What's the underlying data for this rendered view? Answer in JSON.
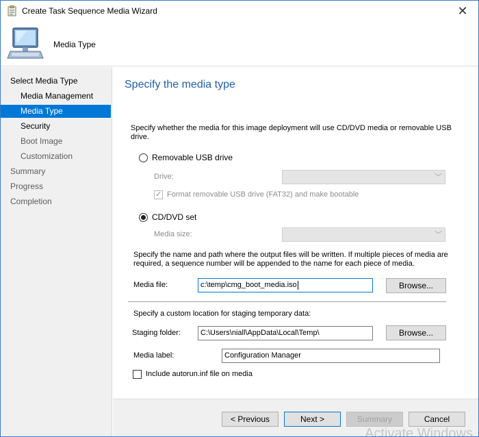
{
  "window": {
    "title": "Create Task Sequence Media Wizard",
    "close_glyph": "✕"
  },
  "header": {
    "title": "Media Type",
    "icon": "computer-monitor-icon"
  },
  "nav": {
    "items": [
      {
        "label": "Select Media Type",
        "level": 0,
        "state": "done"
      },
      {
        "label": "Media Management",
        "level": 1,
        "state": "done"
      },
      {
        "label": "Media Type",
        "level": 1,
        "state": "active"
      },
      {
        "label": "Security",
        "level": 1,
        "state": "done"
      },
      {
        "label": "Boot Image",
        "level": 1,
        "state": "pending"
      },
      {
        "label": "Customization",
        "level": 1,
        "state": "pending"
      },
      {
        "label": "Summary",
        "level": 0,
        "state": "pending"
      },
      {
        "label": "Progress",
        "level": 0,
        "state": "pending"
      },
      {
        "label": "Completion",
        "level": 0,
        "state": "pending"
      }
    ]
  },
  "content": {
    "page_title": "Specify the media type",
    "intro_line1": "Specify whether the media for this image deployment will use CD/DVD media or removable USB",
    "intro_line2": "drive.",
    "usb_option": {
      "label": "Removable USB drive",
      "selected": false
    },
    "drive_label": "Drive:",
    "drive_value": "",
    "format_checkbox": {
      "label": "Format removable USB drive (FAT32) and make bootable",
      "checked": true,
      "enabled": false
    },
    "cd_option": {
      "label": "CD/DVD set",
      "selected": true
    },
    "media_size_label": "Media size:",
    "media_size_value": "",
    "path_note_line1": "Specify the name and path where the output files will be written.  If multiple pieces of media are",
    "path_note_line2": "required, a sequence number will be appended to the name for each piece of media.",
    "media_file_label": "Media file:",
    "media_file_value": "c:\\temp\\cmg_boot_media.iso",
    "browse_label": "Browse...",
    "staging_note": "Specify a custom location for staging temporary data:",
    "staging_label": "Staging folder:",
    "staging_value": "C:\\Users\\niall\\AppData\\Local\\Temp\\",
    "media_label_label": "Media label:",
    "media_label_value": "Configuration Manager",
    "autorun_checkbox": {
      "label": "Include autorun.inf file on media",
      "checked": false
    }
  },
  "footer": {
    "previous": "< Previous",
    "next": "Next >",
    "summary": "Summary",
    "cancel": "Cancel"
  },
  "watermark": "Activate Windows",
  "colors": {
    "accent": "#0078d7",
    "title_blue": "#1e5fa8"
  }
}
